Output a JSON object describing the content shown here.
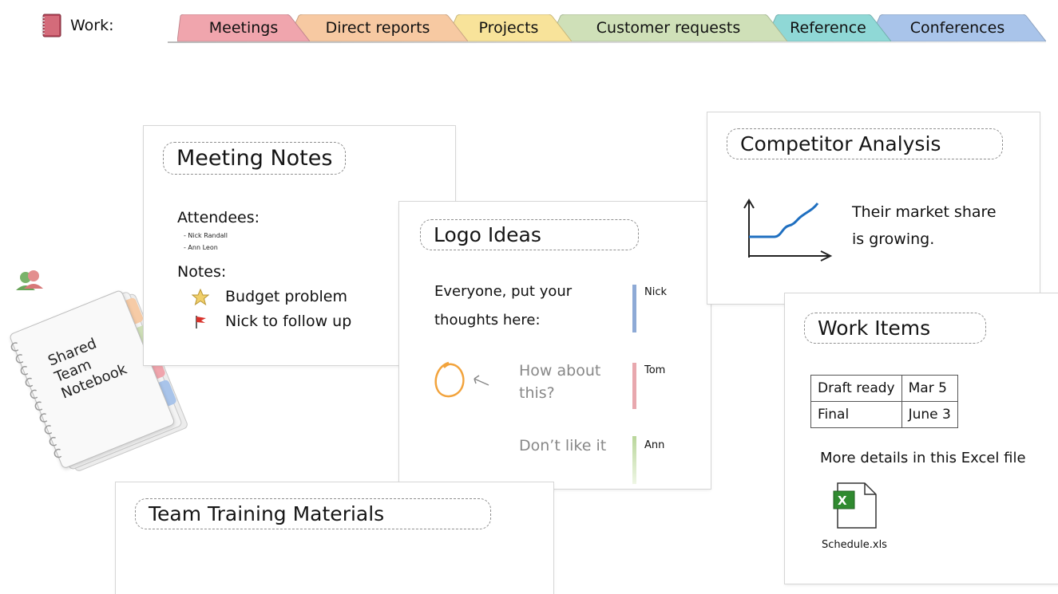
{
  "notebook": {
    "label": "Work:",
    "icon": "notebook-icon"
  },
  "tabs": [
    {
      "label": "Meetings",
      "color": "#f0a5ad"
    },
    {
      "label": "Direct reports",
      "color": "#f7c9a2"
    },
    {
      "label": "Projects",
      "color": "#f8e39a"
    },
    {
      "label": "Customer requests",
      "color": "#cfe0b8"
    },
    {
      "label": "Reference",
      "color": "#8fd8d6"
    },
    {
      "label": "Conferences",
      "color": "#a9c4ea"
    }
  ],
  "shared": {
    "line1": "Shared",
    "line2": "Team",
    "line3": "Notebook",
    "icon": "shared-users-icon"
  },
  "meeting": {
    "title": "Meeting Notes",
    "attendees_label": "Attendees:",
    "attendees": [
      "- Nick Randall",
      "- Ann Leon"
    ],
    "notes_label": "Notes:",
    "items": [
      {
        "icon": "star-icon",
        "text": "Budget problem"
      },
      {
        "icon": "flag-icon",
        "text": "Nick to follow up"
      }
    ]
  },
  "logo": {
    "title": "Logo Ideas",
    "prompt_line1": "Everyone, put your",
    "prompt_line2": "thoughts here:",
    "author1": "Nick",
    "reply1_line1": "How about",
    "reply1_line2": "this?",
    "author2": "Tom",
    "reply2": "Don’t like it",
    "author3": "Ann"
  },
  "competitor": {
    "title": "Competitor Analysis",
    "line1": "Their market share",
    "line2": "is growing."
  },
  "work": {
    "title": "Work Items",
    "rows": [
      [
        "Draft ready",
        "Mar 5"
      ],
      [
        "Final",
        "June 3"
      ]
    ],
    "details": "More details in this Excel file",
    "file_name": "Schedule.xls"
  },
  "training": {
    "title": "Team Training Materials"
  }
}
